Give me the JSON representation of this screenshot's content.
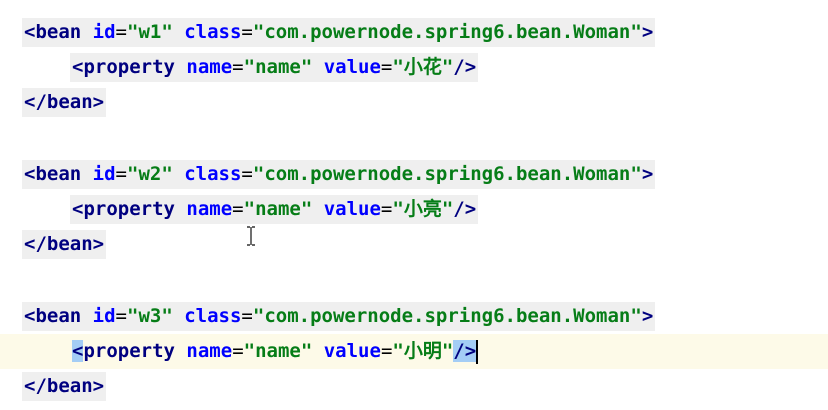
{
  "editor": {
    "lines": [
      {
        "indent": 0,
        "tag_open": "<bean",
        "id_attr": "id",
        "id_value": "\"w1\"",
        "class_attr": "class",
        "class_value": "\"com.powernode.spring6.bean.Woman\"",
        "tag_close": ">"
      },
      {
        "indent": 1,
        "tag_open": "<property",
        "name_attr": "name",
        "name_value": "\"name\"",
        "value_attr": "value",
        "value_value": "\"小花\"",
        "tag_close": "/>"
      },
      {
        "indent": 0,
        "text": "</bean>"
      },
      {
        "indent": 0,
        "tag_open": "<bean",
        "id_attr": "id",
        "id_value": "\"w2\"",
        "class_attr": "class",
        "class_value": "\"com.powernode.spring6.bean.Woman\"",
        "tag_close": ">"
      },
      {
        "indent": 1,
        "tag_open": "<property",
        "name_attr": "name",
        "name_value": "\"name\"",
        "value_attr": "value",
        "value_value": "\"小亮\"",
        "tag_close": "/>"
      },
      {
        "indent": 0,
        "text": "</bean>"
      },
      {
        "indent": 0,
        "tag_open": "<bean",
        "id_attr": "id",
        "id_value": "\"w3\"",
        "class_attr": "class",
        "class_value": "\"com.powernode.spring6.bean.Woman\"",
        "tag_close": ">"
      },
      {
        "indent": 1,
        "tag_open_lt": "<",
        "tag_open_name": "property",
        "name_attr": "name",
        "name_value": "\"name\"",
        "value_attr": "value",
        "value_value": "\"小明\"",
        "tag_close": "/>"
      },
      {
        "indent": 0,
        "text": "</bean>"
      }
    ],
    "eq": "="
  },
  "colors": {
    "tag": "#000080",
    "attribute": "#0000ff",
    "value": "#067d17",
    "current_line": "#fdfae8",
    "brace_highlight": "#a4cdf5",
    "code_block_bg": "#efefef"
  },
  "icons": {
    "mouse_cursor": "ibeam-cursor-icon"
  }
}
